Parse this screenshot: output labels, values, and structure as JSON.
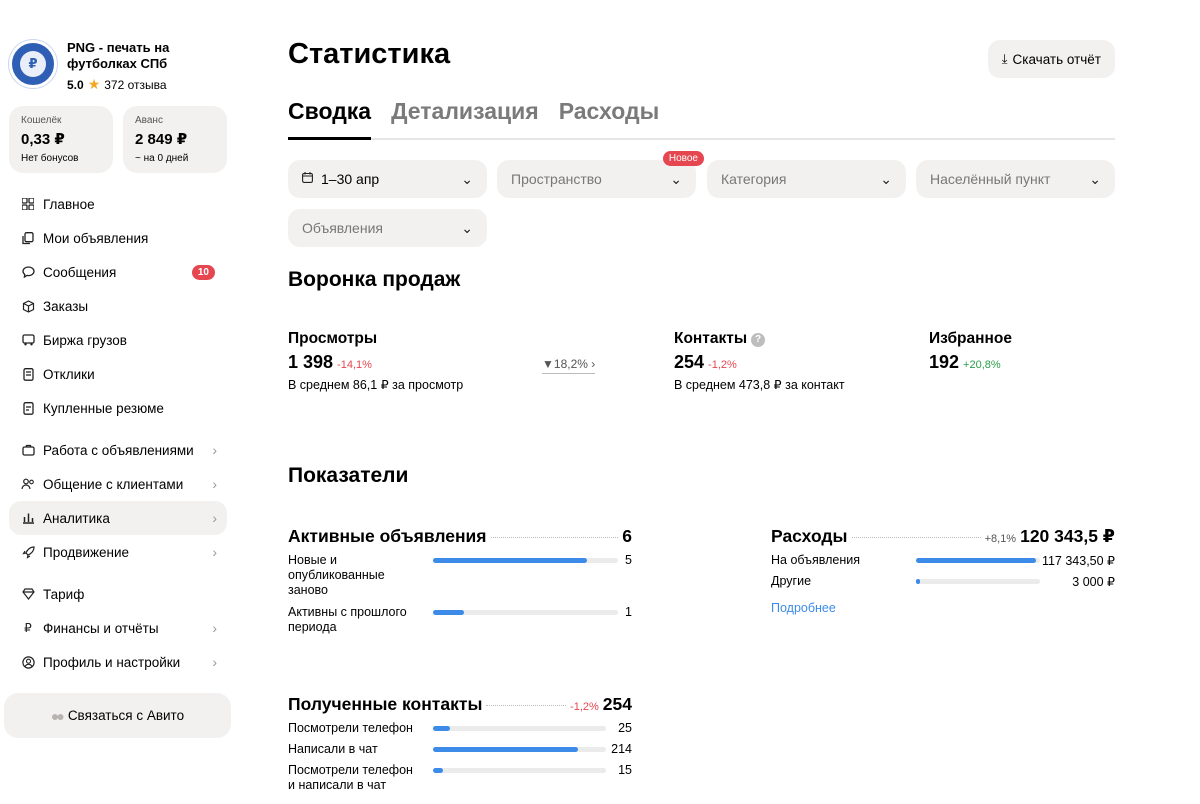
{
  "profile": {
    "name": "PNG - печать на футболках СПб",
    "rating": "5.0",
    "reviews": "372 отзыва"
  },
  "wallets": [
    {
      "label": "Кошелёк",
      "value": "0,33 ₽",
      "sub": "Нет бонусов"
    },
    {
      "label": "Аванс",
      "value": "2 849 ₽",
      "sub": "~ на 0 дней"
    }
  ],
  "nav": {
    "main": "Главное",
    "my_ads": "Мои объявления",
    "messages": "Сообщения",
    "messages_badge": "10",
    "orders": "Заказы",
    "cargo": "Биржа грузов",
    "responses": "Отклики",
    "bought_resumes": "Купленные резюме",
    "ads_work": "Работа с объявлениями",
    "clients": "Общение с клиентами",
    "analytics": "Аналитика",
    "promotion": "Продвижение",
    "tariff": "Тариф",
    "finance": "Финансы и отчёты",
    "settings": "Профиль и настройки"
  },
  "contact_avito": "Связаться с Авито",
  "page": {
    "title": "Статистика",
    "download": "Скачать отчёт"
  },
  "tabs": [
    "Сводка",
    "Детализация",
    "Расходы"
  ],
  "filters": {
    "period": "1–30 апр",
    "space": "Пространство",
    "space_badge": "Новое",
    "category": "Категория",
    "city": "Населённый пункт",
    "ads": "Объявления"
  },
  "funnel": {
    "title": "Воронка продаж",
    "views": {
      "title": "Просмотры",
      "value": "1 398",
      "delta": "-14,1%",
      "sub": "В среднем 86,1 ₽ за просмотр"
    },
    "conversion": "18,2%",
    "contacts": {
      "title": "Контакты",
      "value": "254",
      "delta": "-1,2%",
      "sub": "В среднем 473,8 ₽ за контакт"
    },
    "favorites": {
      "title": "Избранное",
      "value": "192",
      "delta": "+20,8%"
    }
  },
  "metrics": {
    "title": "Показатели",
    "active": {
      "title": "Активные объявления",
      "total": "6",
      "rows": [
        {
          "label": "Новые и опубликованные заново",
          "value": "5",
          "fraction": 0.83
        },
        {
          "label": "Активны с прошлого периода",
          "value": "1",
          "fraction": 0.17
        }
      ]
    },
    "expenses": {
      "title": "Расходы",
      "delta": "+8,1%",
      "total": "120 343,5 ₽",
      "rows": [
        {
          "label": "На объявления",
          "value": "117 343,50 ₽",
          "fraction": 0.97
        },
        {
          "label": "Другие",
          "value": "3 000 ₽",
          "fraction": 0.03
        }
      ],
      "more": "Подробнее"
    },
    "contacts": {
      "title": "Полученные контакты",
      "delta": "-1,2%",
      "total": "254",
      "rows": [
        {
          "label": "Посмотрели телефон",
          "value": "25",
          "fraction": 0.1
        },
        {
          "label": "Написали в чат",
          "value": "214",
          "fraction": 0.84
        },
        {
          "label": "Посмотрели телефон и написали в чат",
          "value": "15",
          "fraction": 0.06
        }
      ]
    }
  }
}
